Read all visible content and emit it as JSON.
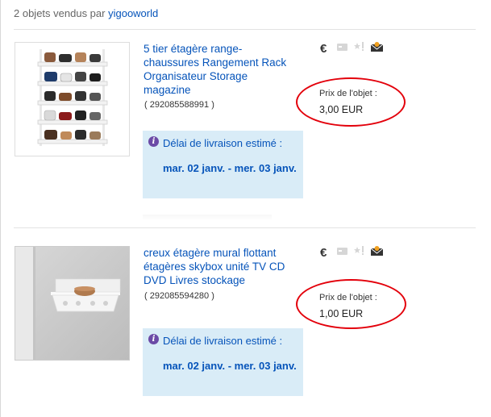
{
  "header": {
    "prefix": "2 objets vendus par",
    "seller": "yigooworld"
  },
  "icons": {
    "euro": "€",
    "names": [
      "euro-icon",
      "shipping-box-icon",
      "feedback-star-icon",
      "envelope-icon"
    ]
  },
  "items": [
    {
      "title": "5 tier étagère range-chaussures Rangement Rack Organisateur Storage magazine",
      "id": "( 292085588991 )",
      "price_label": "Prix de l'objet :",
      "price": "3,00 EUR",
      "delivery_label": "Délai de livraison estimé :",
      "delivery_date": "mar. 02 janv. - mer. 03 janv."
    },
    {
      "title": "creux étagère mural flottant étagères skybox unité TV CD DVD Livres stockage",
      "id": "( 292085594280 )",
      "price_label": "Prix de l'objet :",
      "price": "1,00 EUR",
      "delivery_label": "Délai de livraison estimé :",
      "delivery_date": "mar. 02 janv. - mer. 03 janv."
    }
  ],
  "colors": {
    "link": "#0654ba",
    "delivery_bg": "#d9ecf7",
    "highlight_ring": "#e3000b",
    "info_icon": "#6b4aa6"
  }
}
